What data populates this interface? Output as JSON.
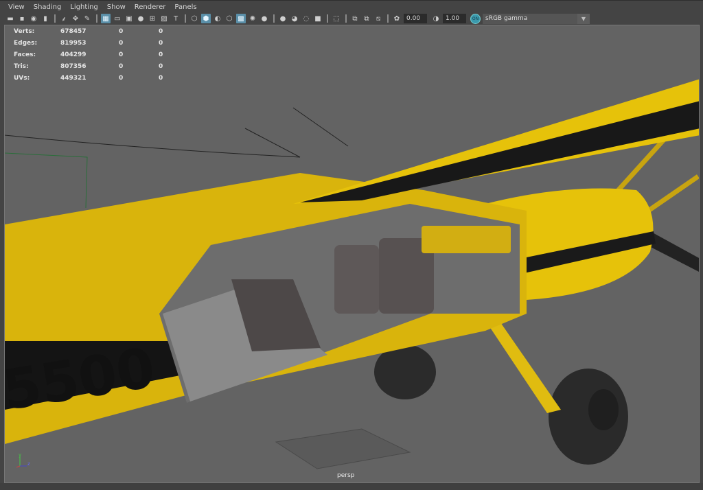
{
  "menu": [
    "View",
    "Shading",
    "Lighting",
    "Show",
    "Renderer",
    "Panels"
  ],
  "toolbar": {
    "icons": [
      {
        "name": "select-camera-icon",
        "g": "▬"
      },
      {
        "name": "lock-camera-icon",
        "g": "▪"
      },
      {
        "name": "camera-attributes-icon",
        "g": "◉"
      },
      {
        "name": "bookmark-icon",
        "g": "▮"
      },
      {
        "sep": true
      },
      {
        "name": "image-plane-icon",
        "g": "⸙"
      },
      {
        "name": "two-d-pan-zoom-icon",
        "g": "✥"
      },
      {
        "name": "grease-pencil-icon",
        "g": "✎"
      },
      {
        "sep": true
      },
      {
        "name": "grid-icon",
        "g": "▦",
        "on": true
      },
      {
        "name": "film-gate-icon",
        "g": "▭"
      },
      {
        "name": "resolution-gate-icon",
        "g": "▣"
      },
      {
        "name": "gate-mask-icon",
        "g": "●"
      },
      {
        "name": "field-chart-icon",
        "g": "⊞"
      },
      {
        "name": "safe-action-icon",
        "g": "▨"
      },
      {
        "name": "safe-title-icon",
        "g": "T"
      },
      {
        "sep": true
      },
      {
        "name": "wireframe-icon",
        "g": "⬡"
      },
      {
        "name": "smooth-shade-icon",
        "g": "⬢",
        "on": true
      },
      {
        "name": "default-material-icon",
        "g": "◐"
      },
      {
        "name": "wireframe-on-shaded-icon",
        "g": "⬡"
      },
      {
        "name": "textured-icon",
        "g": "▩",
        "on": true
      },
      {
        "name": "use-all-lights-icon",
        "g": "✺"
      },
      {
        "name": "shadows-icon",
        "g": "●"
      },
      {
        "sep": true
      },
      {
        "name": "screen-space-ao-icon",
        "g": "●"
      },
      {
        "name": "motion-blur-icon",
        "g": "◕"
      },
      {
        "name": "anti-aliasing-icon",
        "g": "◌"
      },
      {
        "name": "depth-of-field-icon",
        "g": "■"
      },
      {
        "sep": true
      },
      {
        "name": "isolate-select-icon",
        "g": "⬚"
      },
      {
        "sep": true
      },
      {
        "name": "xray-icon",
        "g": "⧉"
      },
      {
        "name": "xray-joints-icon",
        "g": "⧉"
      },
      {
        "name": "xray-components-icon",
        "g": "⧅"
      },
      {
        "sep": true
      },
      {
        "name": "exposure-icon",
        "g": "✿"
      }
    ],
    "exposure": "0.00",
    "gamma_icon": "gamma-icon",
    "gamma": "1.00",
    "color_mgmt": "ON",
    "color_space": "sRGB gamma"
  },
  "stats": [
    {
      "label": "Verts:",
      "values": [
        "678457",
        "0",
        "0"
      ]
    },
    {
      "label": "Edges:",
      "values": [
        "819953",
        "0",
        "0"
      ]
    },
    {
      "label": "Faces:",
      "values": [
        "404299",
        "0",
        "0"
      ]
    },
    {
      "label": "Tris:",
      "values": [
        "807356",
        "0",
        "0"
      ]
    },
    {
      "label": "UVs:",
      "values": [
        "449321",
        "0",
        "0"
      ]
    }
  ],
  "viewport": {
    "camera": "persp",
    "tail_number": "5500",
    "axis": {
      "y": "y",
      "z": "z"
    }
  },
  "colors": {
    "viewport_bg": "#636363",
    "plane_yellow": "#e6c20a",
    "accent": "#5a8fa8"
  }
}
